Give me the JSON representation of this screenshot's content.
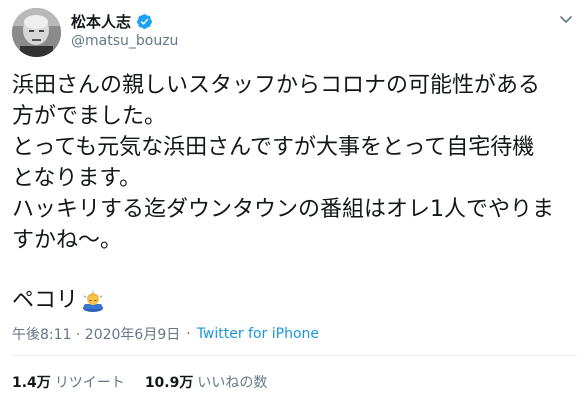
{
  "user": {
    "name": "松本人志",
    "handle": "@matsu_bouzu"
  },
  "tweet": {
    "text": "浜田さんの親しいスタッフからコロナの可能性がある\n方がでました。\nとっても元気な浜田さんですが大事をとって自宅待機\nとなります。\nハッキリする迄ダウンタウンの番組はオレ1人でやりま\nすかね〜。",
    "closing": "ペコリ",
    "closing_emoji": "bowing-person-icon"
  },
  "meta": {
    "time": "午後8:11 · 2020年6月9日",
    "separator": "·",
    "source": "Twitter for iPhone"
  },
  "stats": {
    "retweets_count": "1.4万",
    "retweets_label": "リツイート",
    "likes_count": "10.9万",
    "likes_label": "いいねの数"
  },
  "colors": {
    "accent": "#1b95e0",
    "verified": "#1da1f2",
    "muted": "#657786"
  }
}
